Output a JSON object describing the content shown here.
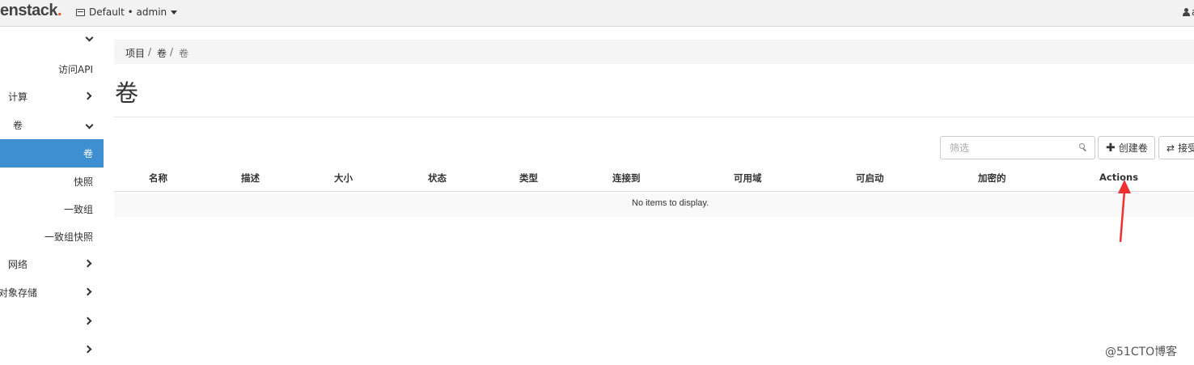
{
  "topbar": {
    "brand": "enstack",
    "brand_dot": ".",
    "project_label": "Default • admin",
    "user_tail": "a"
  },
  "sidebar": {
    "access_api": "访问API",
    "compute": "计算",
    "volumes_group": "卷",
    "volumes": "卷",
    "snapshots": "快照",
    "consistency_groups": "一致组",
    "cg_snapshots": "一致组快照",
    "network": "网络",
    "object_store": "对象存储"
  },
  "breadcrumb": {
    "items": [
      "项目",
      "卷",
      "卷"
    ],
    "sep": "/"
  },
  "page": {
    "title": "卷"
  },
  "toolbar": {
    "filter_placeholder": "筛选",
    "create_label": "创建卷",
    "accept_label": "接受"
  },
  "table": {
    "columns": [
      "名称",
      "描述",
      "大小",
      "状态",
      "类型",
      "连接到",
      "可用域",
      "可启动",
      "加密的",
      "Actions"
    ],
    "empty_text": "No items to display."
  },
  "annotation": {
    "color": "#f03030"
  },
  "watermark": "@51CTO博客"
}
